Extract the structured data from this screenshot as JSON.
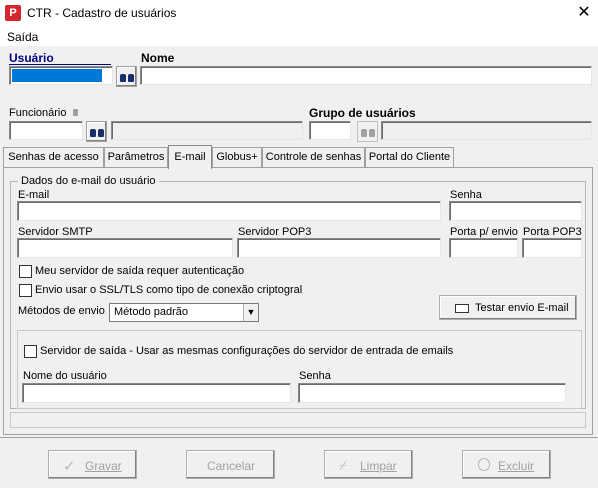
{
  "window": {
    "app_icon_text": "P",
    "title": "CTR - Cadastro de usuários",
    "close_glyph": "✕"
  },
  "menu": {
    "items": [
      "Saída"
    ]
  },
  "header": {
    "usuario_label": "Usuário",
    "nome_label": "Nome",
    "funcionario_label": "Funcionário",
    "grupo_label": "Grupo de usuários"
  },
  "tabs": [
    {
      "label": "Senhas de acesso",
      "active": false
    },
    {
      "label": "Parâmetros",
      "active": false
    },
    {
      "label": "E-mail",
      "active": true
    },
    {
      "label": "Globus+",
      "active": false
    },
    {
      "label": "Controle de senhas",
      "active": false
    },
    {
      "label": "Portal do Cliente",
      "active": false
    }
  ],
  "email_tab": {
    "group_title": "Dados do e-mail do usuário",
    "email_label": "E-mail",
    "senha_label": "Senha",
    "smtp_label": "Servidor SMTP",
    "pop3_label": "Servidor POP3",
    "porta_envio_label": "Porta p/ envio",
    "porta_pop3_label": "Porta POP3",
    "auth_checkbox_label": "Meu servidor de saída requer autenticação",
    "ssl_checkbox_label": "Envio usar o SSL/TLS como tipo de conexão criptogral",
    "metodos_label": "Métodos de envio",
    "metodos_value": "Método padrão",
    "testar_button": "Testar envio E-mail",
    "saida_checkbox_label": "Servidor de saída - Usar as mesmas configurações do servidor de entrada de emails",
    "nome_usuario_label": "Nome do usuário",
    "senha2_label": "Senha"
  },
  "footer": {
    "gravar": "Gravar",
    "cancelar": "Cancelar",
    "limpar": "Limpar",
    "excluir": "Excluir"
  }
}
